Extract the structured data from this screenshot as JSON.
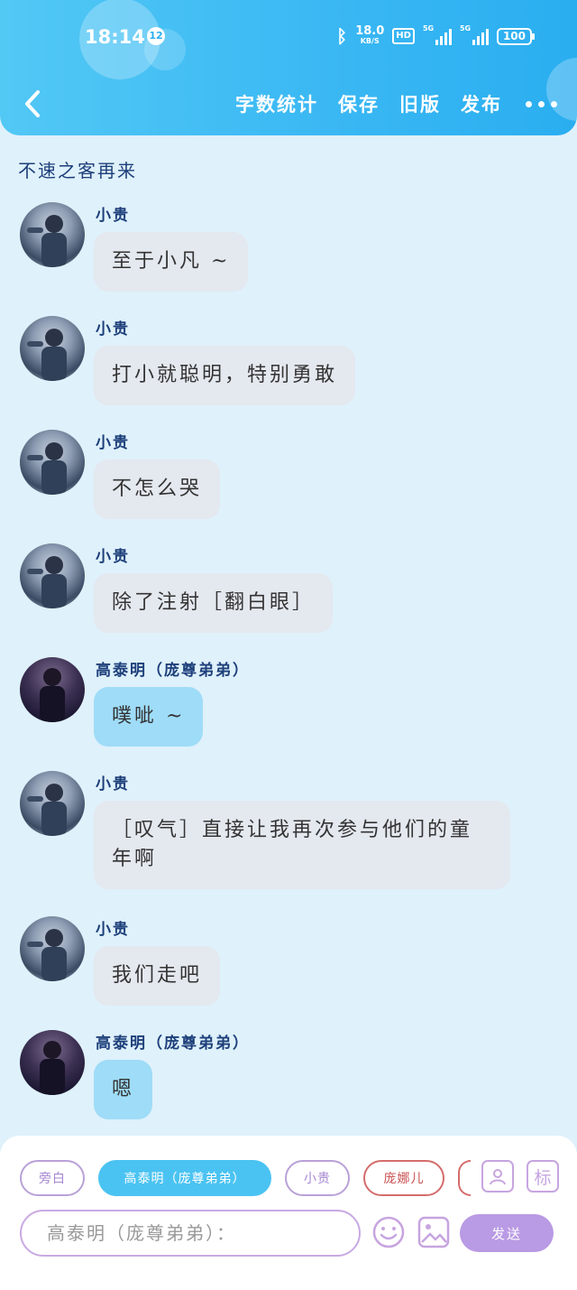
{
  "status_bar": {
    "time": "18:14",
    "notification_count": "12",
    "net_speed_value": "18.0",
    "net_speed_unit": "KB/S",
    "hd_label": "HD",
    "signal_1_label": "5G",
    "signal_2_label": "5G",
    "battery": "100"
  },
  "nav": {
    "word_count": "字数统计",
    "save": "保存",
    "old_version": "旧版",
    "publish": "发布"
  },
  "story_title": "不速之客再来",
  "messages": [
    {
      "sender": "小贵",
      "text": "至于小凡 ~",
      "style": "gray"
    },
    {
      "sender": "小贵",
      "text": "打小就聪明，特别勇敢",
      "style": "gray"
    },
    {
      "sender": "小贵",
      "text": "不怎么哭",
      "style": "gray"
    },
    {
      "sender": "小贵",
      "text": "除了注射［翻白眼］",
      "style": "gray"
    },
    {
      "sender": "高泰明（庞尊弟弟）",
      "text": "噗呲 ~",
      "style": "blue"
    },
    {
      "sender": "小贵",
      "text_line1": "［叹气］直接让我再次参与他们的童",
      "text_line2": "年啊",
      "style": "gray"
    },
    {
      "sender": "小贵",
      "text": "我们走吧",
      "style": "gray"
    },
    {
      "sender": "高泰明（庞尊弟弟）",
      "text": "嗯",
      "style": "blue"
    }
  ],
  "role_chips": {
    "narrator": "旁白",
    "gao_taiming": "高泰明（庞尊弟弟）",
    "xiaogui": "小贵",
    "pang_naer": "庞娜儿"
  },
  "tag_button": "标",
  "input": {
    "value": "高泰明（庞尊弟弟）："
  },
  "send_label": "发送",
  "colors": {
    "header": "#39b7f3",
    "background": "#dff1fb",
    "bubble_gray": "#e4e8ef",
    "bubble_blue": "#9fdcf8",
    "accent_purple": "#b99ae4",
    "name_color": "#1d3f7a"
  }
}
